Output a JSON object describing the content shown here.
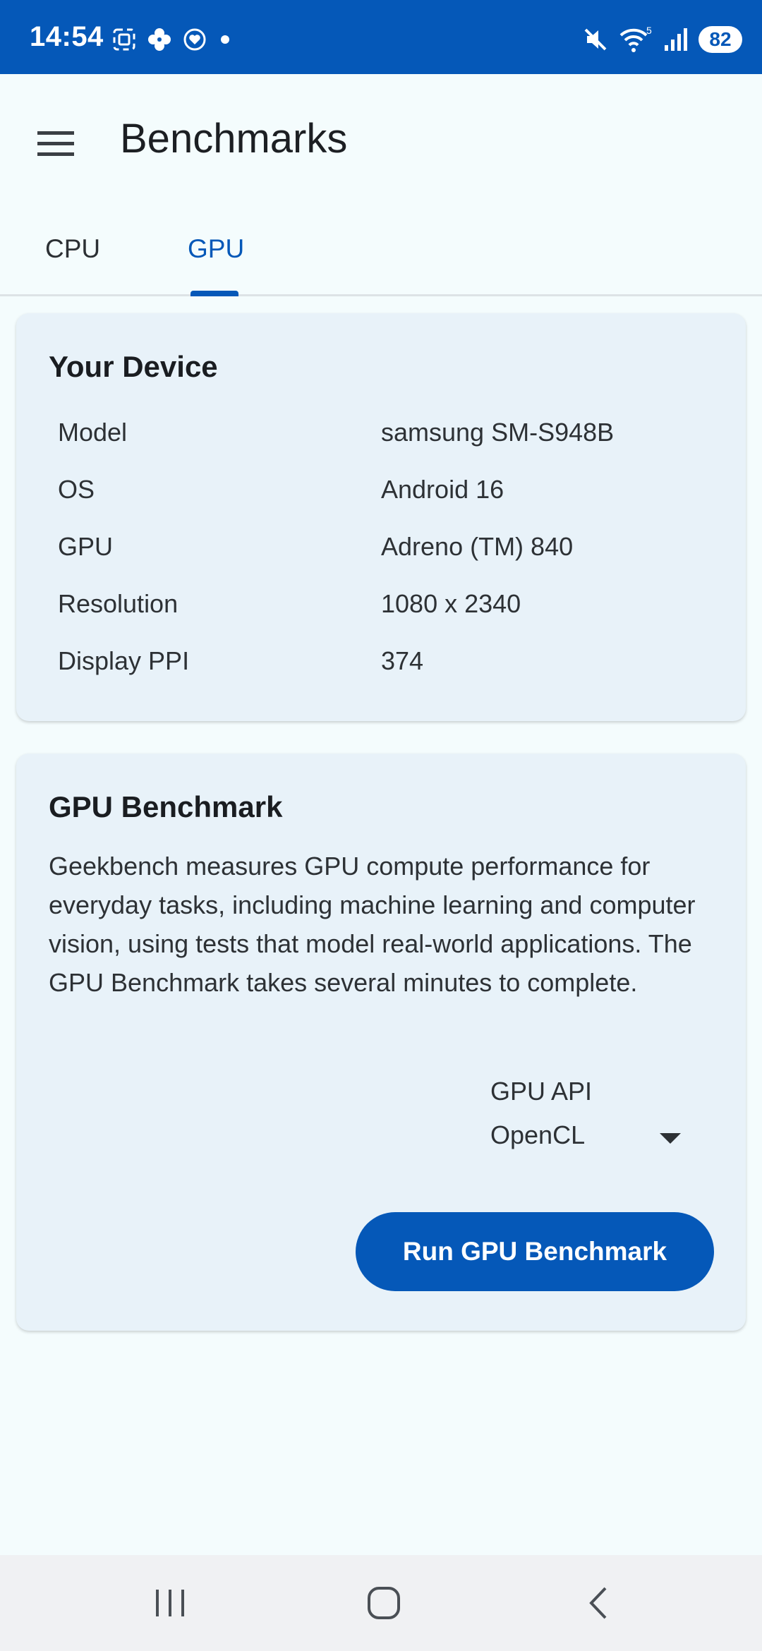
{
  "status_bar": {
    "time": "14:54",
    "battery": "82",
    "left_icons": [
      "screenshot-icon",
      "pinwheel-icon",
      "heart-circle-icon",
      "dot-icon"
    ],
    "right_icons": [
      "mute-icon",
      "wifi-icon",
      "signal-icon"
    ],
    "wifi_badge": "5",
    "background": "#0558b8"
  },
  "app_bar": {
    "title": "Benchmarks",
    "menu_icon": "hamburger-menu-icon"
  },
  "tabs": [
    {
      "label": "CPU",
      "selected": false
    },
    {
      "label": "GPU",
      "selected": true
    }
  ],
  "device_card": {
    "title": "Your Device",
    "rows": [
      {
        "label": "Model",
        "value": "samsung SM-S948B"
      },
      {
        "label": "OS",
        "value": "Android 16"
      },
      {
        "label": "GPU",
        "value": "Adreno (TM) 840"
      },
      {
        "label": "Resolution",
        "value": "1080 x 2340"
      },
      {
        "label": "Display PPI",
        "value": "374"
      }
    ]
  },
  "benchmark_card": {
    "title": "GPU Benchmark",
    "description": "Geekbench measures GPU compute performance for everyday tasks, including machine learning and computer vision, using tests that model real-world applications. The GPU Benchmark takes several minutes to complete.",
    "api_label": "GPU API",
    "api_selected": "OpenCL",
    "run_button": "Run GPU Benchmark"
  },
  "colors": {
    "accent": "#0558b8",
    "background": "#f4fcfd",
    "card": "#e8f2f9"
  },
  "nav_bar": {
    "buttons": [
      "recents-icon",
      "home-icon",
      "back-icon"
    ]
  }
}
